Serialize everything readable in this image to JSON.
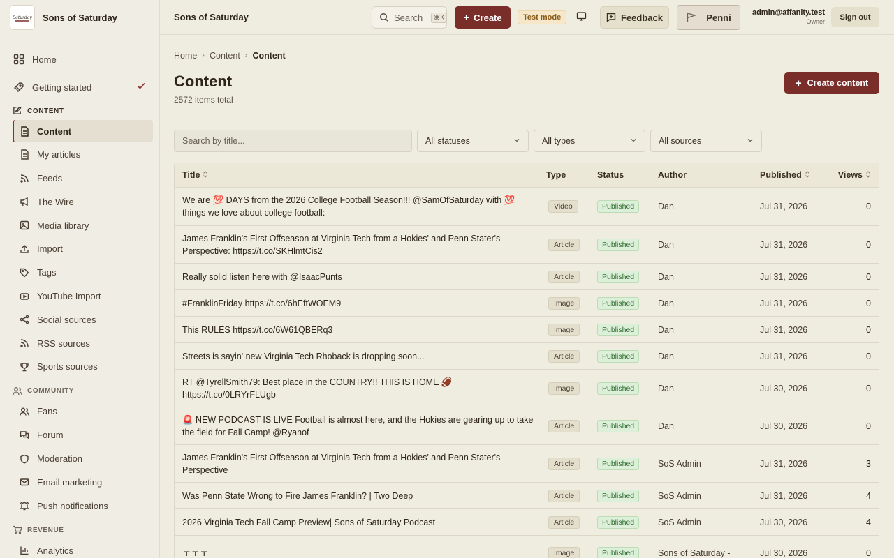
{
  "app": {
    "brand_name": "Sons of Saturday",
    "logo_text": "Sons of Saturday",
    "header_title": "Sons of Saturday"
  },
  "header": {
    "search_label": "Search",
    "search_shortcut": "⌘K",
    "create_label": "Create",
    "test_mode_label": "Test mode",
    "feedback_label": "Feedback",
    "penni_label": "Penni",
    "user_email": "admin@affanity.test",
    "user_role": "Owner",
    "signout_label": "Sign out"
  },
  "sidebar": {
    "home": "Home",
    "getting_started": "Getting started",
    "section_content": "CONTENT",
    "content_items": [
      "Content",
      "My articles",
      "Feeds",
      "The Wire",
      "Media library",
      "Import",
      "Tags",
      "YouTube Import",
      "Social sources",
      "RSS sources",
      "Sports sources"
    ],
    "section_community": "COMMUNITY",
    "community_items": [
      "Fans",
      "Forum",
      "Moderation",
      "Email marketing",
      "Push notifications"
    ],
    "section_revenue": "REVENUE",
    "revenue_items": [
      "Analytics"
    ]
  },
  "main": {
    "breadcrumb": [
      "Home",
      "Content",
      "Content"
    ],
    "title": "Content",
    "count": "2572 items total",
    "create_content_label": "Create content",
    "search_placeholder": "Search by title...",
    "filter_status": "All statuses",
    "filter_type": "All types",
    "filter_source": "All sources"
  },
  "table": {
    "columns": [
      "Title",
      "Type",
      "Status",
      "Author",
      "Published",
      "Views"
    ],
    "rows": [
      {
        "title": "We are 💯 DAYS from the 2026 College Football Season!!! @SamOfSaturday with 💯 things we love about college football:",
        "type": "Video",
        "status": "Published",
        "author": "Dan",
        "published": "Jul 31, 2026",
        "views": "0"
      },
      {
        "title": "James Franklin's First Offseason at Virginia Tech from a Hokies' and Penn Stater's Perspective: https://t.co/SKHlmtCis2",
        "type": "Article",
        "status": "Published",
        "author": "Dan",
        "published": "Jul 31, 2026",
        "views": "0"
      },
      {
        "title": "Really solid listen here with @IsaacPunts",
        "type": "Article",
        "status": "Published",
        "author": "Dan",
        "published": "Jul 31, 2026",
        "views": "0"
      },
      {
        "title": "#FranklinFriday https://t.co/6hEftWOEM9",
        "type": "Image",
        "status": "Published",
        "author": "Dan",
        "published": "Jul 31, 2026",
        "views": "0"
      },
      {
        "title": "This RULES https://t.co/6W61QBERq3",
        "type": "Image",
        "status": "Published",
        "author": "Dan",
        "published": "Jul 31, 2026",
        "views": "0"
      },
      {
        "title": "Streets is sayin' new Virginia Tech Rhoback is dropping soon...",
        "type": "Article",
        "status": "Published",
        "author": "Dan",
        "published": "Jul 31, 2026",
        "views": "0"
      },
      {
        "title": "RT @TyrellSmith79: Best place in the COUNTRY!! THIS IS HOME 🏈 https://t.co/0LRYrFLUgb",
        "type": "Image",
        "status": "Published",
        "author": "Dan",
        "published": "Jul 30, 2026",
        "views": "0"
      },
      {
        "title": "🚨 NEW PODCAST IS LIVE Football is almost here, and the Hokies are gearing up to take the field for Fall Camp! @Ryanof",
        "type": "Article",
        "status": "Published",
        "author": "Dan",
        "published": "Jul 30, 2026",
        "views": "0"
      },
      {
        "title": "James Franklin's First Offseason at Virginia Tech from a Hokies' and Penn Stater's Perspective",
        "type": "Article",
        "status": "Published",
        "author": "SoS Admin",
        "published": "Jul 31, 2026",
        "views": "3"
      },
      {
        "title": "Was Penn State Wrong to Fire James Franklin? | Two Deep",
        "type": "Article",
        "status": "Published",
        "author": "SoS Admin",
        "published": "Jul 31, 2026",
        "views": "4"
      },
      {
        "title": "2026 Virginia Tech Fall Camp Preview| Sons of Saturday Podcast",
        "type": "Article",
        "status": "Published",
        "author": "SoS Admin",
        "published": "Jul 30, 2026",
        "views": "4"
      },
      {
        "title": "〒〒〒",
        "type": "Image",
        "status": "Published",
        "author": "Sons of Saturday -",
        "published": "Jul 30, 2026",
        "views": "0"
      }
    ]
  }
}
